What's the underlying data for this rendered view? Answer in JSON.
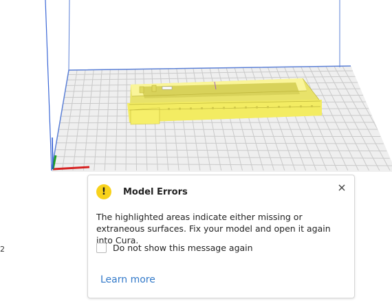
{
  "viewport": {
    "side_label": "2",
    "colors": {
      "grid_line": "#c8c8c8",
      "grid_bg": "#efefef",
      "plate_edge": "#5a7fd6",
      "model": "#f4ee6a",
      "axis_x": "#d62020",
      "axis_y": "#20a020",
      "axis_z": "#2050d0"
    }
  },
  "dialog": {
    "icon": "warning-icon",
    "title": "Model Errors",
    "body": "The highlighted areas indicate either missing or extraneous surfaces. Fix your model and open it again into Cura.",
    "checkbox_label": "Do not show this message again",
    "checkbox_checked": false,
    "link_label": "Learn more",
    "accent": "#3279c9",
    "warning_color": "#f8d21c"
  }
}
